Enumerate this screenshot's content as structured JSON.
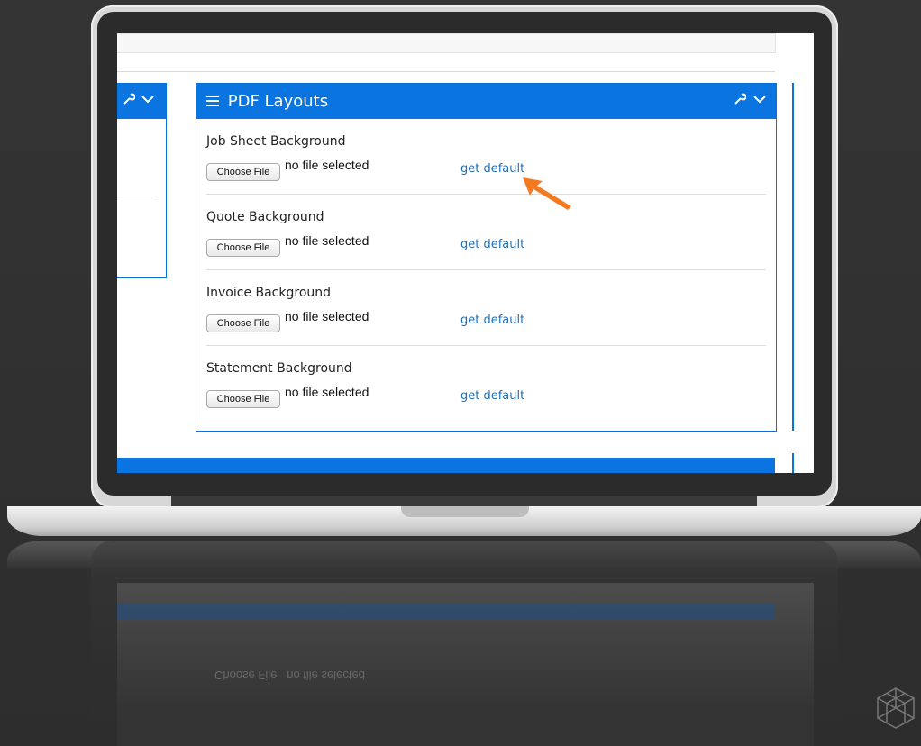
{
  "panel": {
    "title": "PDF Layouts",
    "rows": [
      {
        "label": "Job Sheet Background",
        "choose": "Choose File",
        "status": "no file selected",
        "link": "get default"
      },
      {
        "label": "Quote Background",
        "choose": "Choose File",
        "status": "no file selected",
        "link": "get default"
      },
      {
        "label": "Invoice Background",
        "choose": "Choose File",
        "status": "no file selected",
        "link": "get default"
      },
      {
        "label": "Statement Background",
        "choose": "Choose File",
        "status": "no file selected",
        "link": "get default"
      }
    ]
  },
  "icons": {
    "menu": "hamburger-icon",
    "settings": "wrench-icon",
    "collapse": "chevron-down-icon",
    "callout": "arrow-pointer-icon"
  },
  "colors": {
    "accent": "#0a74e0",
    "link": "#1f6fb3",
    "arrow": "#f47a20"
  }
}
